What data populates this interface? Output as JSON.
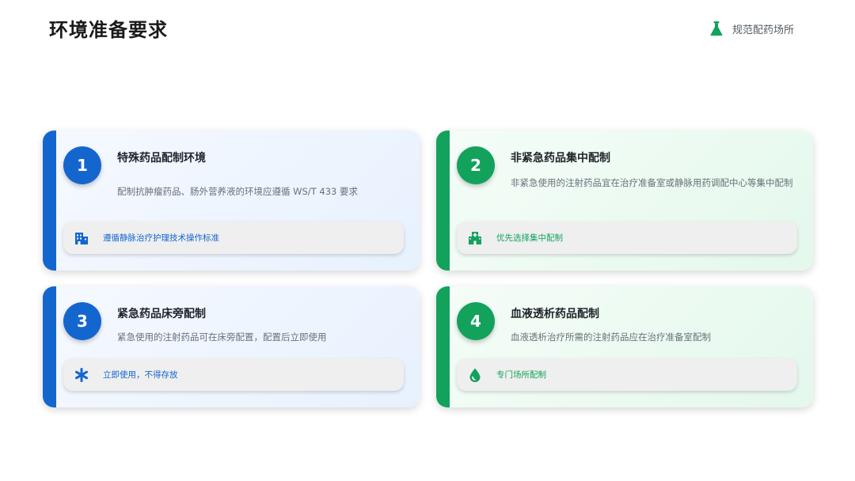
{
  "page": {
    "title": "环境准备要求",
    "tag_icon": "flask-icon",
    "tag_label": "规范配药场所",
    "accent_blue": "#1466cf",
    "accent_green": "#13a25c"
  },
  "cards": [
    {
      "number": "1",
      "title": "特殊药品配制环境",
      "description": "配制抗肿瘤药品、肠外营养液的环境应遵循 WS/T 433 要求",
      "highlight_icon": "building-icon",
      "highlight": "遵循静脉治疗护理技术操作标准",
      "theme": "blue"
    },
    {
      "number": "2",
      "title": "非紧急药品集中配制",
      "description": "非紧急使用的注射药品宜在治疗准备室或静脉用药调配中心等集中配制",
      "highlight_icon": "hospital-icon",
      "highlight": "优先选择集中配制",
      "theme": "green"
    },
    {
      "number": "3",
      "title": "紧急药品床旁配制",
      "description": "紧急使用的注射药品可在床旁配置，配置后立即使用",
      "highlight_icon": "asterisk-icon",
      "highlight": "立即使用，不得存放",
      "theme": "blue"
    },
    {
      "number": "4",
      "title": "血液透析药品配制",
      "description": "血液透析治疗所需的注射药品应在治疗准备室配制",
      "highlight_icon": "droplet-icon",
      "highlight": "专门场所配制",
      "theme": "green"
    }
  ]
}
